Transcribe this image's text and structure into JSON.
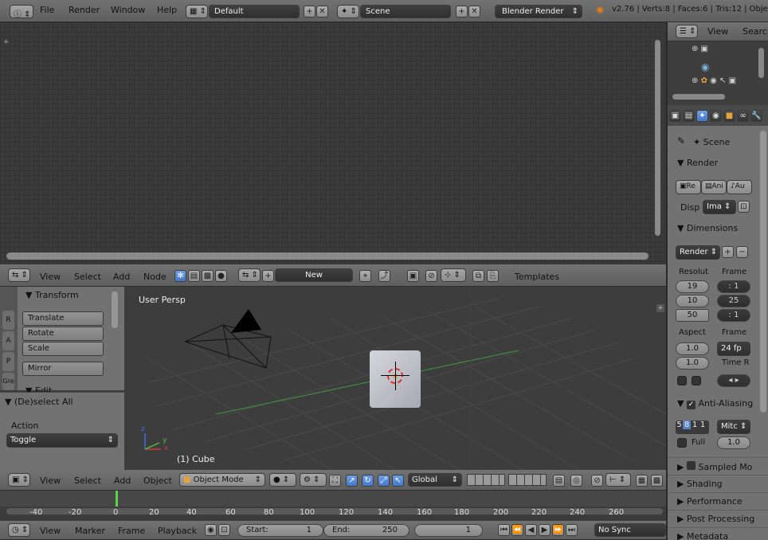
{
  "top_menu": {
    "file": "File",
    "render": "Render",
    "window": "Window",
    "help": "Help",
    "screen_layout": "Default",
    "scene": "Scene",
    "engine": "Blender Render",
    "stats": "v2.76 | Verts:8 | Faces:6 | Tris:12 | Objec"
  },
  "outliner": {
    "view": "View",
    "search": "Search"
  },
  "node_header": {
    "view": "View",
    "select": "Select",
    "add": "Add",
    "node": "Node",
    "new": "New",
    "templates": "Templates"
  },
  "tool_shelf": {
    "tabs": [
      "Gre",
      "P",
      "A",
      "R"
    ],
    "transform_title": "Transform",
    "translate": "Translate",
    "rotate": "Rotate",
    "scale": "Scale",
    "mirror": "Mirror",
    "edit_title": "Edit"
  },
  "operator": {
    "title": "(De)select All",
    "action_label": "Action",
    "action_value": "Toggle"
  },
  "viewport": {
    "label": "User Persp",
    "object_label": "(1) Cube",
    "axis_x": "x",
    "axis_y": "y",
    "axis_z": "z"
  },
  "view3d_header": {
    "view": "View",
    "select": "Select",
    "add": "Add",
    "object": "Object",
    "mode": "Object Mode",
    "orientation": "Global"
  },
  "timeline": {
    "ticks": [
      "-40",
      "-20",
      "0",
      "20",
      "40",
      "60",
      "80",
      "100",
      "120",
      "140",
      "160",
      "180",
      "200",
      "220",
      "240",
      "260"
    ],
    "current_frame_marker": 1
  },
  "timeline_header": {
    "view": "View",
    "marker": "Marker",
    "frame": "Frame",
    "playback": "Playback",
    "start_label": "Start:",
    "start_value": "1",
    "end_label": "End:",
    "end_value": "250",
    "current": "1",
    "sync": "No Sync"
  },
  "properties": {
    "scene_label": "Scene",
    "render_title": "Render",
    "render_btn": "Re",
    "anim_btn": "Ani",
    "audio_btn": "Au",
    "display_label": "Disp",
    "display_value": "Ima",
    "dimensions_title": "Dimensions",
    "presets": "Render",
    "resolution_label": "Resolut",
    "frame_label": "Frame",
    "res_x": "19",
    "res_y": "10",
    "res_pct": "50",
    "frame_start": ": 1",
    "frame_end": "25",
    "frame_step": ": 1",
    "aspect_label": "Aspect",
    "frame_rate_label": "Frame",
    "aspect_x": "1.0",
    "aspect_y": "1.0",
    "fps": "24 fp",
    "time_remap_label": "Time R",
    "aa_title": "Anti-Aliasing",
    "aa_samples": [
      "5",
      "8",
      "1",
      "1"
    ],
    "aa_filter": "Mitc",
    "full_label": "Full",
    "full_value": "1.0",
    "sampled_motion": "Sampled Mo",
    "shading": "Shading",
    "performance": "Performance",
    "post_processing": "Post Processing",
    "metadata": "Metadata"
  }
}
